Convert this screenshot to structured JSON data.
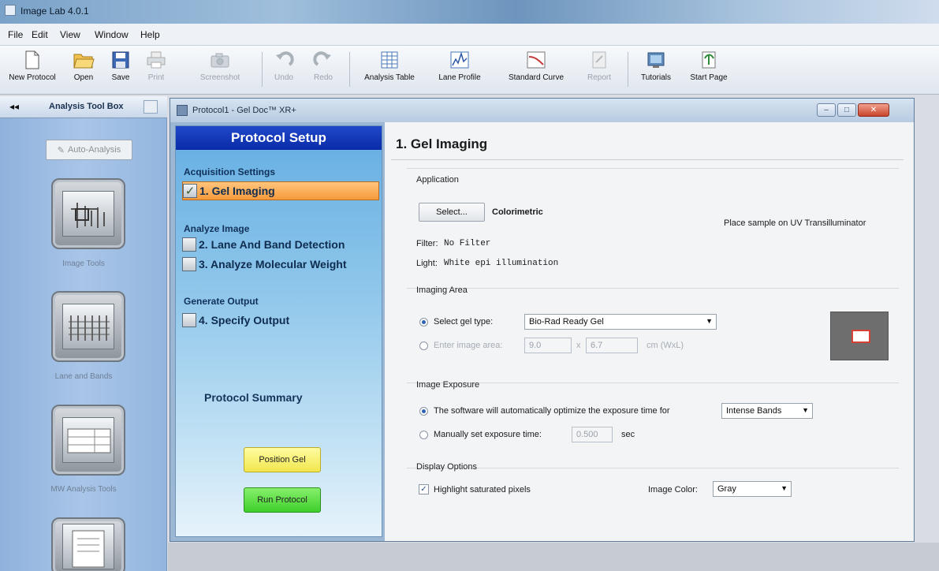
{
  "app": {
    "title": "Image Lab 4.0.1"
  },
  "menu": [
    "File",
    "Edit",
    "View",
    "Window",
    "Help"
  ],
  "toolbar": [
    {
      "label": "New Protocol",
      "icon": "new-document-icon",
      "enabled": true
    },
    {
      "label": "Open",
      "icon": "open-folder-icon",
      "enabled": true
    },
    {
      "label": "Save",
      "icon": "save-disk-icon",
      "enabled": true
    },
    {
      "label": "Print",
      "icon": "printer-icon",
      "enabled": false
    },
    {
      "label": "Screenshot",
      "icon": "camera-icon",
      "enabled": false
    },
    {
      "label": "Undo",
      "icon": "undo-icon",
      "enabled": false
    },
    {
      "label": "Redo",
      "icon": "redo-icon",
      "enabled": false
    },
    {
      "label": "Analysis Table",
      "icon": "table-icon",
      "enabled": true
    },
    {
      "label": "Lane Profile",
      "icon": "lane-profile-icon",
      "enabled": true
    },
    {
      "label": "Standard Curve",
      "icon": "standard-curve-icon",
      "enabled": true
    },
    {
      "label": "Report",
      "icon": "report-icon",
      "enabled": false
    },
    {
      "label": "Tutorials",
      "icon": "tutorials-icon",
      "enabled": true
    },
    {
      "label": "Start Page",
      "icon": "start-page-icon",
      "enabled": true
    }
  ],
  "toolbox": {
    "title": "Analysis Tool Box",
    "collapse": "◂◂",
    "auto_analysis": "Auto-Analysis",
    "tools": [
      "Image Tools",
      "Lane and Bands",
      "MW Analysis Tools"
    ]
  },
  "window": {
    "title": "Protocol1 - Gel Doc™ XR+"
  },
  "protocol": {
    "header": "Protocol Setup",
    "acquisition": "Acquisition Settings",
    "step1": "1. Gel Imaging",
    "analyze": "Analyze Image",
    "step2": "2. Lane And Band Detection",
    "step3": "3. Analyze Molecular Weight",
    "generate": "Generate Output",
    "step4": "4. Specify Output",
    "summary": "Protocol Summary",
    "position_gel": "Position Gel",
    "run_protocol": "Run Protocol"
  },
  "content": {
    "title": "1. Gel Imaging",
    "application": {
      "label": "Application",
      "select_button": "Select...",
      "value": "Colorimetric",
      "hint": "Place sample on UV Transilluminator",
      "filter_label": "Filter:",
      "filter_value": "No Filter",
      "light_label": "Light:",
      "light_value": "White epi illumination"
    },
    "imaging_area": {
      "label": "Imaging Area",
      "select_gel_label": "Select gel type:",
      "gel_type": "Bio-Rad Ready Gel",
      "enter_area_label": "Enter image area:",
      "width": "9.0",
      "x": "x",
      "length": "6.7",
      "unit": "cm (WxL)"
    },
    "exposure": {
      "label": "Image Exposure",
      "auto_label": "The software will automatically optimize the exposure time for",
      "auto_value": "Intense Bands",
      "manual_label": "Manually set exposure time:",
      "manual_value": "0.500",
      "manual_unit": "sec"
    },
    "display": {
      "label": "Display Options",
      "highlight_label": "Highlight saturated pixels",
      "color_label": "Image Color:",
      "color_value": "Gray"
    }
  }
}
